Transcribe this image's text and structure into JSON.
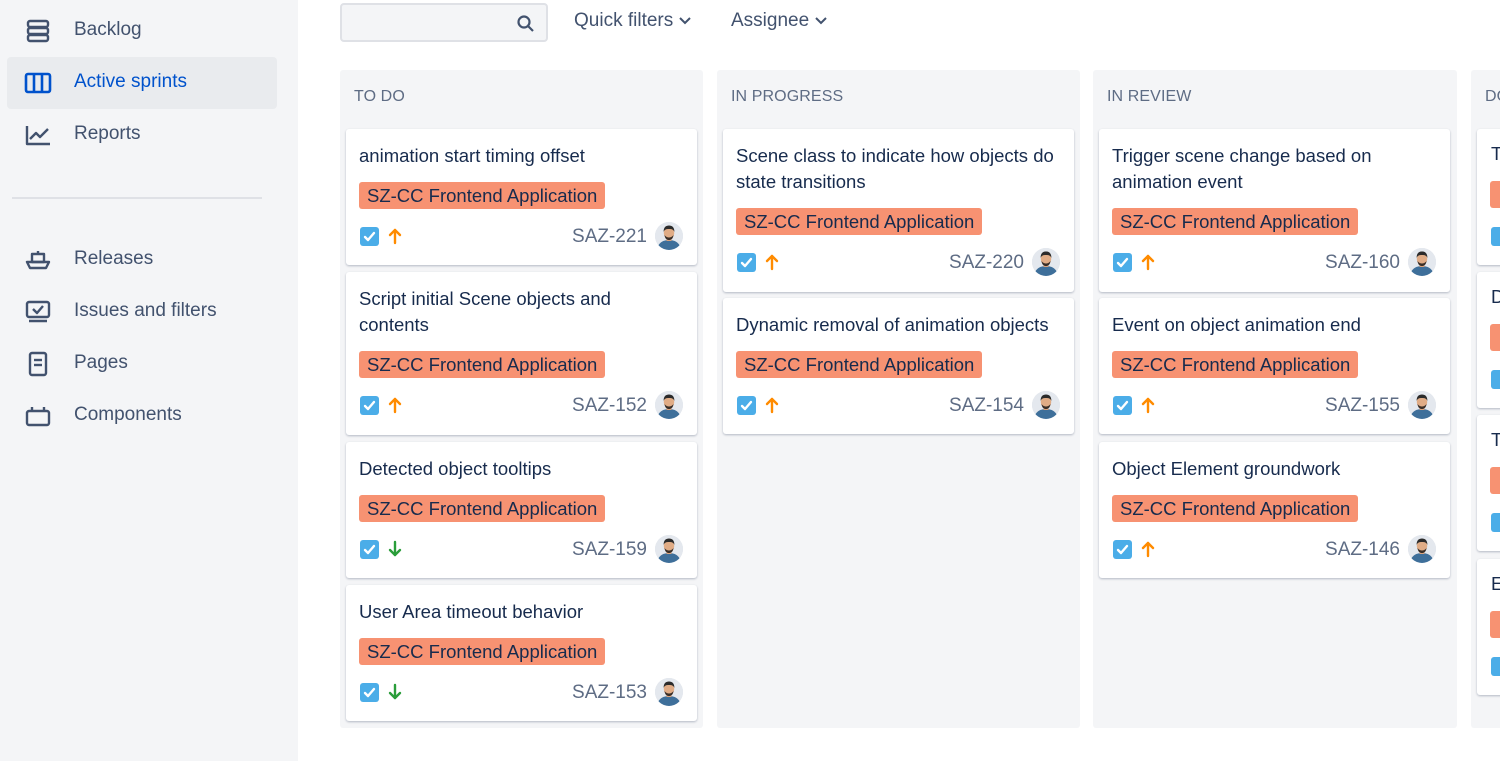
{
  "sidebar": {
    "items": [
      {
        "label": "Backlog",
        "icon": "backlog-icon"
      },
      {
        "label": "Active sprints",
        "icon": "board-icon",
        "active": true
      },
      {
        "label": "Reports",
        "icon": "reports-icon"
      },
      {
        "label": "Releases",
        "icon": "ship-icon"
      },
      {
        "label": "Issues and filters",
        "icon": "issues-icon"
      },
      {
        "label": "Pages",
        "icon": "page-icon"
      },
      {
        "label": "Components",
        "icon": "component-icon"
      }
    ]
  },
  "filters": {
    "search_placeholder": "",
    "quick_filters": "Quick filters",
    "assignee": "Assignee"
  },
  "colors": {
    "accent": "#0052cc",
    "epic": "#f79272",
    "task": "#4bade8",
    "priority_high": "#ff8b00",
    "priority_low": "#2a9d3a"
  },
  "columns": [
    {
      "title": "TO DO",
      "cards": [
        {
          "summary": "animation start timing offset",
          "epic": "SZ-CC Frontend Application",
          "key": "SAZ-221",
          "priority": "high"
        },
        {
          "summary": "Script initial Scene objects and contents",
          "epic": "SZ-CC Frontend Application",
          "key": "SAZ-152",
          "priority": "high"
        },
        {
          "summary": "Detected object tooltips",
          "epic": "SZ-CC Frontend Application",
          "key": "SAZ-159",
          "priority": "low"
        },
        {
          "summary": "User Area timeout behavior",
          "epic": "SZ-CC Frontend Application",
          "key": "SAZ-153",
          "priority": "low"
        }
      ]
    },
    {
      "title": "IN PROGRESS",
      "cards": [
        {
          "summary": "Scene class to indicate how objects do state transitions",
          "epic": "SZ-CC Frontend Application",
          "key": "SAZ-220",
          "priority": "high"
        },
        {
          "summary": "Dynamic removal of animation objects",
          "epic": "SZ-CC Frontend Application",
          "key": "SAZ-154",
          "priority": "high"
        }
      ]
    },
    {
      "title": "IN REVIEW",
      "cards": [
        {
          "summary": "Trigger scene change based on animation event",
          "epic": "SZ-CC Frontend Application",
          "key": "SAZ-160",
          "priority": "high"
        },
        {
          "summary": "Event on object animation end",
          "epic": "SZ-CC Frontend Application",
          "key": "SAZ-155",
          "priority": "high"
        },
        {
          "summary": "Object Element groundwork",
          "epic": "SZ-CC Frontend Application",
          "key": "SAZ-146",
          "priority": "high"
        }
      ]
    },
    {
      "title": "DO",
      "cards": [
        {
          "summary": "T"
        },
        {
          "summary": "D"
        },
        {
          "summary": "T"
        },
        {
          "summary": "E"
        }
      ]
    }
  ]
}
